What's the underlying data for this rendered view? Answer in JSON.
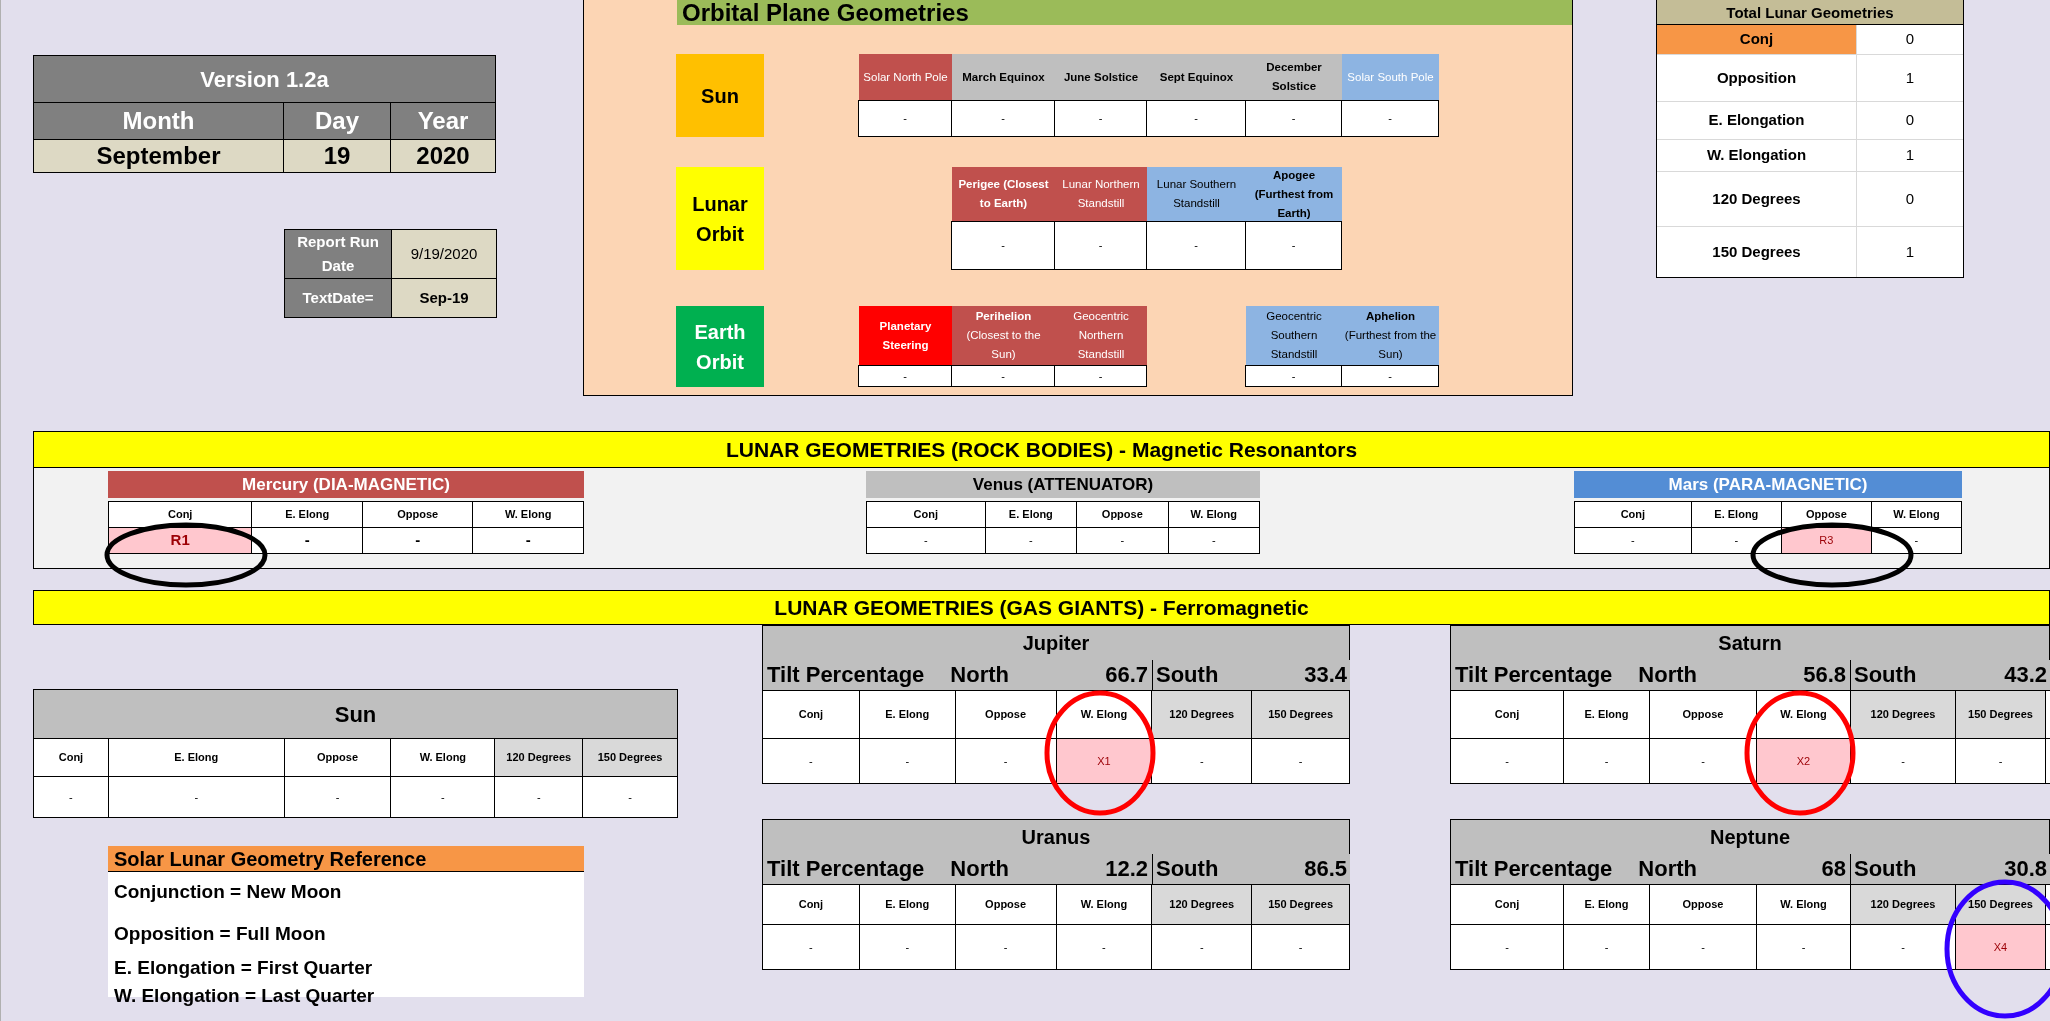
{
  "version": {
    "title": "Version 1.2a",
    "headers": [
      "Month",
      "Day",
      "Year"
    ],
    "values": [
      "September",
      "19",
      "2020"
    ]
  },
  "report": {
    "rows": [
      {
        "label": "Report Run Date",
        "value": "9/19/2020",
        "bold": false
      },
      {
        "label": "TextDate=",
        "value": "Sep-19",
        "bold": true
      }
    ]
  },
  "orbital": {
    "title": "Orbital Plane Geometries",
    "rows": [
      {
        "label": "Sun",
        "color": "#ffc000",
        "light_text": false,
        "cells": [
          {
            "kind": "cell",
            "header": "Solar North Pole",
            "color": "#c0504d",
            "light_text": true,
            "bold": false,
            "value": "-"
          },
          {
            "kind": "cell",
            "header": "March Equinox",
            "color": "#bfbfbf",
            "light_text": false,
            "bold": true,
            "value": "-"
          },
          {
            "kind": "cell",
            "header": "June Solstice",
            "color": "#bfbfbf",
            "light_text": false,
            "bold": true,
            "value": "-"
          },
          {
            "kind": "cell",
            "header": "Sept Equinox",
            "color": "#bfbfbf",
            "light_text": false,
            "bold": true,
            "value": "-"
          },
          {
            "kind": "cell",
            "header": "December Solstice",
            "color": "#bfbfbf",
            "light_text": false,
            "bold": true,
            "value": "-"
          },
          {
            "kind": "cell",
            "header": "Solar South Pole",
            "color": "#8db4e2",
            "light_text": true,
            "bold": false,
            "value": "-"
          }
        ]
      },
      {
        "label": "Lunar Orbit",
        "color": "#ffff00",
        "light_text": false,
        "cells": [
          {
            "kind": "empty"
          },
          {
            "kind": "cell",
            "header": "Perigee (Closest to Earth)",
            "color": "#c0504d",
            "light_text": true,
            "bold": true,
            "value": "-"
          },
          {
            "kind": "cell",
            "header": "Lunar Northern Standstill",
            "color": "#c0504d",
            "light_text": true,
            "bold": false,
            "value": "-"
          },
          {
            "kind": "cell",
            "header": "Lunar Southern Standstill",
            "color": "#8db4e2",
            "light_text": false,
            "bold": false,
            "value": "-"
          },
          {
            "kind": "cell",
            "header": "Apogee (Furthest from Earth)",
            "color": "#8db4e2",
            "light_text": false,
            "bold": true,
            "value": "-"
          },
          {
            "kind": "empty"
          }
        ]
      },
      {
        "label": "Earth Orbit",
        "color": "#00b050",
        "light_text": true,
        "cells": [
          {
            "kind": "cell",
            "header": "Planetary Steering",
            "color": "#ff0000",
            "light_text": true,
            "bold": true,
            "value": "-"
          },
          {
            "kind": "cell",
            "header": "**Perihelion** (Closest to the Sun)",
            "color": "#c0504d",
            "light_text": true,
            "bold": false,
            "value": "-"
          },
          {
            "kind": "cell",
            "header": "Geocentric Northern Standstill",
            "color": "#c0504d",
            "light_text": true,
            "bold": false,
            "value": "-"
          },
          {
            "kind": "empty"
          },
          {
            "kind": "cell",
            "header": "Geocentric Southern Standstill",
            "color": "#8db4e2",
            "light_text": false,
            "bold": false,
            "value": "-"
          },
          {
            "kind": "cell",
            "header": "**Aphelion** (Furthest from the Sun)",
            "color": "#8db4e2",
            "light_text": false,
            "bold": false,
            "value": "-"
          }
        ]
      }
    ]
  },
  "totals": {
    "title": "Total Lunar Geometries",
    "rows": [
      {
        "label": "Conj",
        "value": "0",
        "selected": true
      },
      {
        "label": "Opposition",
        "value": "1",
        "selected": false
      },
      {
        "label": "E. Elongation",
        "value": "0",
        "selected": false
      },
      {
        "label": "W. Elongation",
        "value": "1",
        "selected": false
      },
      {
        "label": "120 Degrees",
        "value": "0",
        "selected": false
      },
      {
        "label": "150 Degrees",
        "value": "1",
        "selected": false
      }
    ]
  },
  "rock": {
    "title": "LUNAR GEOMETRIES (ROCK BODIES) - Magnetic Resonantors",
    "planets": [
      {
        "name": "Mercury (DIA-MAGNETIC)",
        "color": "#c0504d",
        "light_text": true,
        "bold_values": true,
        "columns": [
          "Conj",
          "E. Elong",
          "Oppose",
          "W. Elong"
        ],
        "values": [
          {
            "text": "R1",
            "highlighted": true,
            "annotation": {
              "color": "#000000"
            }
          },
          {
            "text": "-",
            "highlighted": false
          },
          {
            "text": "-",
            "highlighted": false
          },
          {
            "text": "-",
            "highlighted": false
          }
        ]
      },
      {
        "name": "Venus (ATTENUATOR)",
        "color": "#bfbfbf",
        "light_text": false,
        "bold_values": false,
        "columns": [
          "Conj",
          "E. Elong",
          "Oppose",
          "W. Elong"
        ],
        "values": [
          {
            "text": "-",
            "highlighted": false
          },
          {
            "text": "-",
            "highlighted": false
          },
          {
            "text": "-",
            "highlighted": false
          },
          {
            "text": "-",
            "highlighted": false
          }
        ]
      },
      {
        "name": "Mars (PARA-MAGNETIC)",
        "color": "#538dd5",
        "light_text": true,
        "bold_values": false,
        "columns": [
          "Conj",
          "E. Elong",
          "Oppose",
          "W. Elong"
        ],
        "values": [
          {
            "text": "-",
            "highlighted": false
          },
          {
            "text": "-",
            "highlighted": false
          },
          {
            "text": "R3",
            "highlighted": true,
            "annotation": {
              "color": "#000000"
            }
          },
          {
            "text": "-",
            "highlighted": false
          }
        ]
      }
    ]
  },
  "gas": {
    "title": "LUNAR GEOMETRIES (GAS GIANTS) - Ferromagnetic",
    "sun": {
      "title": "Sun",
      "columns": [
        {
          "label": "Conj",
          "shaded": false
        },
        {
          "label": "E. Elong",
          "shaded": false
        },
        {
          "label": "Oppose",
          "shaded": false
        },
        {
          "label": "W. Elong",
          "shaded": false
        },
        {
          "label": "120 Degrees",
          "shaded": true
        },
        {
          "label": "150 Degrees",
          "shaded": true
        }
      ],
      "values": [
        {
          "text": "-",
          "highlighted": false
        },
        {
          "text": "-",
          "highlighted": false
        },
        {
          "text": "-",
          "highlighted": false
        },
        {
          "text": "-",
          "highlighted": false
        },
        {
          "text": "-",
          "highlighted": false
        },
        {
          "text": "-",
          "highlighted": false
        }
      ]
    },
    "planets": [
      {
        "name": "Jupiter",
        "tilt": {
          "label": "Tilt Percentage",
          "north_label": "North",
          "north": "66.7",
          "south_label": "South",
          "south": "33.4"
        },
        "columns": [
          {
            "label": "Conj",
            "shaded": false
          },
          {
            "label": "E. Elong",
            "shaded": false
          },
          {
            "label": "Oppose",
            "shaded": false
          },
          {
            "label": "W. Elong",
            "shaded": false
          },
          {
            "label": "120 Degrees",
            "shaded": true
          },
          {
            "label": "150 Degrees",
            "shaded": true
          }
        ],
        "values": [
          {
            "text": "-",
            "highlighted": false
          },
          {
            "text": "-",
            "highlighted": false
          },
          {
            "text": "-",
            "highlighted": false
          },
          {
            "text": "X1",
            "highlighted": true,
            "annotation": {
              "color": "#ff0000"
            }
          },
          {
            "text": "-",
            "highlighted": false
          },
          {
            "text": "-",
            "highlighted": false
          }
        ]
      },
      {
        "name": "Saturn",
        "tilt": {
          "label": "Tilt Percentage",
          "north_label": "North",
          "north": "56.8",
          "south_label": "South",
          "south": "43.2"
        },
        "columns": [
          {
            "label": "Conj",
            "shaded": false
          },
          {
            "label": "E. Elong",
            "shaded": false
          },
          {
            "label": "Oppose",
            "shaded": false
          },
          {
            "label": "W. Elong",
            "shaded": false
          },
          {
            "label": "120 Degrees",
            "shaded": true
          },
          {
            "label": "150 Degrees",
            "shaded": true
          }
        ],
        "values": [
          {
            "text": "-",
            "highlighted": false
          },
          {
            "text": "-",
            "highlighted": false
          },
          {
            "text": "-",
            "highlighted": false
          },
          {
            "text": "X2",
            "highlighted": true,
            "annotation": {
              "color": "#ff0000"
            }
          },
          {
            "text": "-",
            "highlighted": false
          },
          {
            "text": "-",
            "highlighted": false
          }
        ]
      },
      {
        "name": "Uranus",
        "tilt": {
          "label": "Tilt Percentage",
          "north_label": "North",
          "north": "12.2",
          "south_label": "South",
          "south": "86.5"
        },
        "columns": [
          {
            "label": "Conj",
            "shaded": false
          },
          {
            "label": "E. Elong",
            "shaded": false
          },
          {
            "label": "Oppose",
            "shaded": false
          },
          {
            "label": "W. Elong",
            "shaded": false
          },
          {
            "label": "120 Degrees",
            "shaded": true
          },
          {
            "label": "150 Degrees",
            "shaded": true
          }
        ],
        "values": [
          {
            "text": "-",
            "highlighted": false
          },
          {
            "text": "-",
            "highlighted": false
          },
          {
            "text": "-",
            "highlighted": false
          },
          {
            "text": "-",
            "highlighted": false
          },
          {
            "text": "-",
            "highlighted": false
          },
          {
            "text": "-",
            "highlighted": false
          }
        ]
      },
      {
        "name": "Neptune",
        "tilt": {
          "label": "Tilt Percentage",
          "north_label": "North",
          "north": "68",
          "south_label": "South",
          "south": "30.8"
        },
        "columns": [
          {
            "label": "Conj",
            "shaded": false
          },
          {
            "label": "E. Elong",
            "shaded": false
          },
          {
            "label": "Oppose",
            "shaded": false
          },
          {
            "label": "W. Elong",
            "shaded": false
          },
          {
            "label": "120 Degrees",
            "shaded": true
          },
          {
            "label": "150 Degrees",
            "shaded": true
          }
        ],
        "values": [
          {
            "text": "-",
            "highlighted": false
          },
          {
            "text": "-",
            "highlighted": false
          },
          {
            "text": "-",
            "highlighted": false
          },
          {
            "text": "-",
            "highlighted": false
          },
          {
            "text": "-",
            "highlighted": false
          },
          {
            "text": "X4",
            "highlighted": true,
            "annotation": {
              "color": "#3300ff"
            }
          }
        ]
      }
    ]
  },
  "reference": {
    "title": "Solar Lunar Geometry Reference",
    "lines": [
      "Conjunction = New Moon",
      "Opposition = Full Moon",
      "E. Elongation = First Quarter",
      "W. Elongation = Last Quarter"
    ]
  }
}
